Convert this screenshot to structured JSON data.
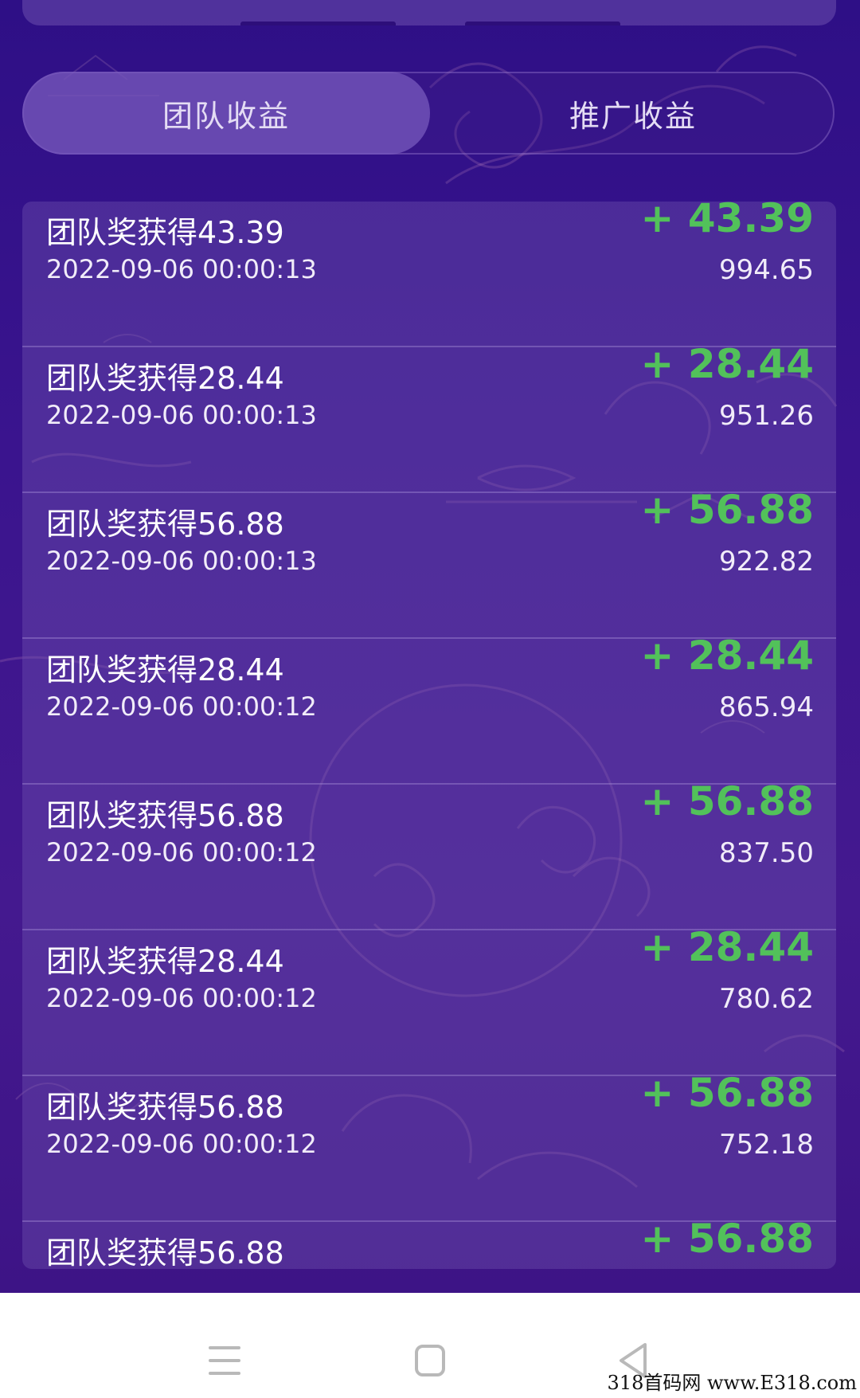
{
  "tabs": [
    {
      "label": "团队收益",
      "active": true
    },
    {
      "label": "推广收益",
      "active": false
    }
  ],
  "records": [
    {
      "title": "团队奖获得43.39",
      "time": "2022-09-06 00:00:13",
      "amount": "+ 43.39",
      "balance": "994.65"
    },
    {
      "title": "团队奖获得28.44",
      "time": "2022-09-06 00:00:13",
      "amount": "+ 28.44",
      "balance": "951.26"
    },
    {
      "title": "团队奖获得56.88",
      "time": "2022-09-06 00:00:13",
      "amount": "+ 56.88",
      "balance": "922.82"
    },
    {
      "title": "团队奖获得28.44",
      "time": "2022-09-06 00:00:12",
      "amount": "+ 28.44",
      "balance": "865.94"
    },
    {
      "title": "团队奖获得56.88",
      "time": "2022-09-06 00:00:12",
      "amount": "+ 56.88",
      "balance": "837.50"
    },
    {
      "title": "团队奖获得28.44",
      "time": "2022-09-06 00:00:12",
      "amount": "+ 28.44",
      "balance": "780.62"
    },
    {
      "title": "团队奖获得56.88",
      "time": "2022-09-06 00:00:12",
      "amount": "+ 56.88",
      "balance": "752.18"
    },
    {
      "title": "团队奖获得56.88",
      "time": "",
      "amount": "+ 56.88",
      "balance": ""
    }
  ],
  "navbar": {
    "buttons": [
      {
        "name": "menu-icon"
      },
      {
        "name": "home-icon"
      },
      {
        "name": "back-icon"
      }
    ]
  },
  "watermark": "318首码网 www.E318.com",
  "colors": {
    "background": "#3a148e",
    "amount": "#52c15a",
    "navbar": "#ffffff"
  }
}
